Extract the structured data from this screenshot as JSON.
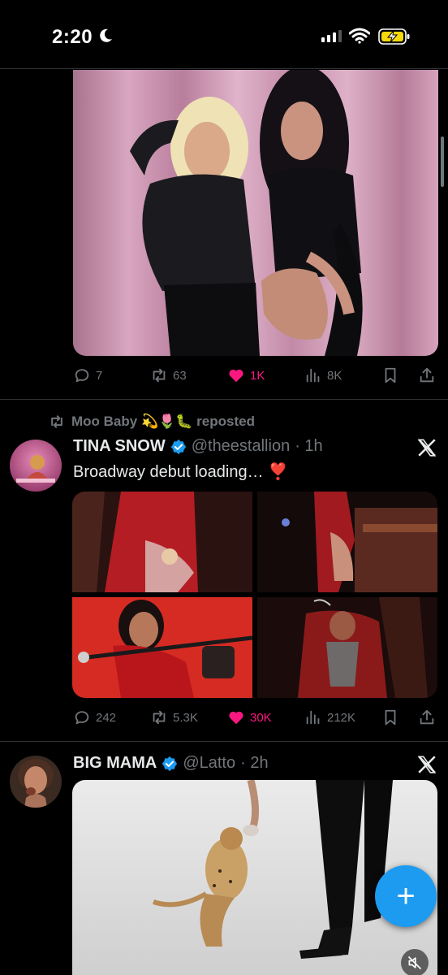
{
  "status_bar": {
    "time": "2:20",
    "icons": [
      "moon-icon",
      "signal-icon",
      "wifi-icon",
      "battery-charging-icon"
    ]
  },
  "colors": {
    "background": "#000000",
    "like": "#f91880",
    "verified": "#1d9bf0",
    "muted_text": "#71767b",
    "fab": "#1d9bf0"
  },
  "feed": [
    {
      "media": "photo of two women posing in front of a pink curtain",
      "actions": {
        "replies": "7",
        "reposts": "63",
        "likes": "1K",
        "views": "8K",
        "liked": true
      }
    },
    {
      "repost_label": "Moo Baby 💫🌷🐛 reposted",
      "author": {
        "name": "TINA SNOW",
        "handle": "@theestallion",
        "time": "· 1h",
        "verified": true
      },
      "text": "Broadway debut loading… ❣️",
      "actions": {
        "replies": "242",
        "reposts": "5.3K",
        "likes": "30K",
        "views": "212K",
        "liked": true
      }
    },
    {
      "author": {
        "name": "BIG MAMA",
        "handle": "@Latto",
        "time": "· 2h",
        "verified": true
      },
      "media": "photo of a cheetah cub reaching up to a woman in heels"
    }
  ],
  "fab": {
    "label": "+"
  }
}
